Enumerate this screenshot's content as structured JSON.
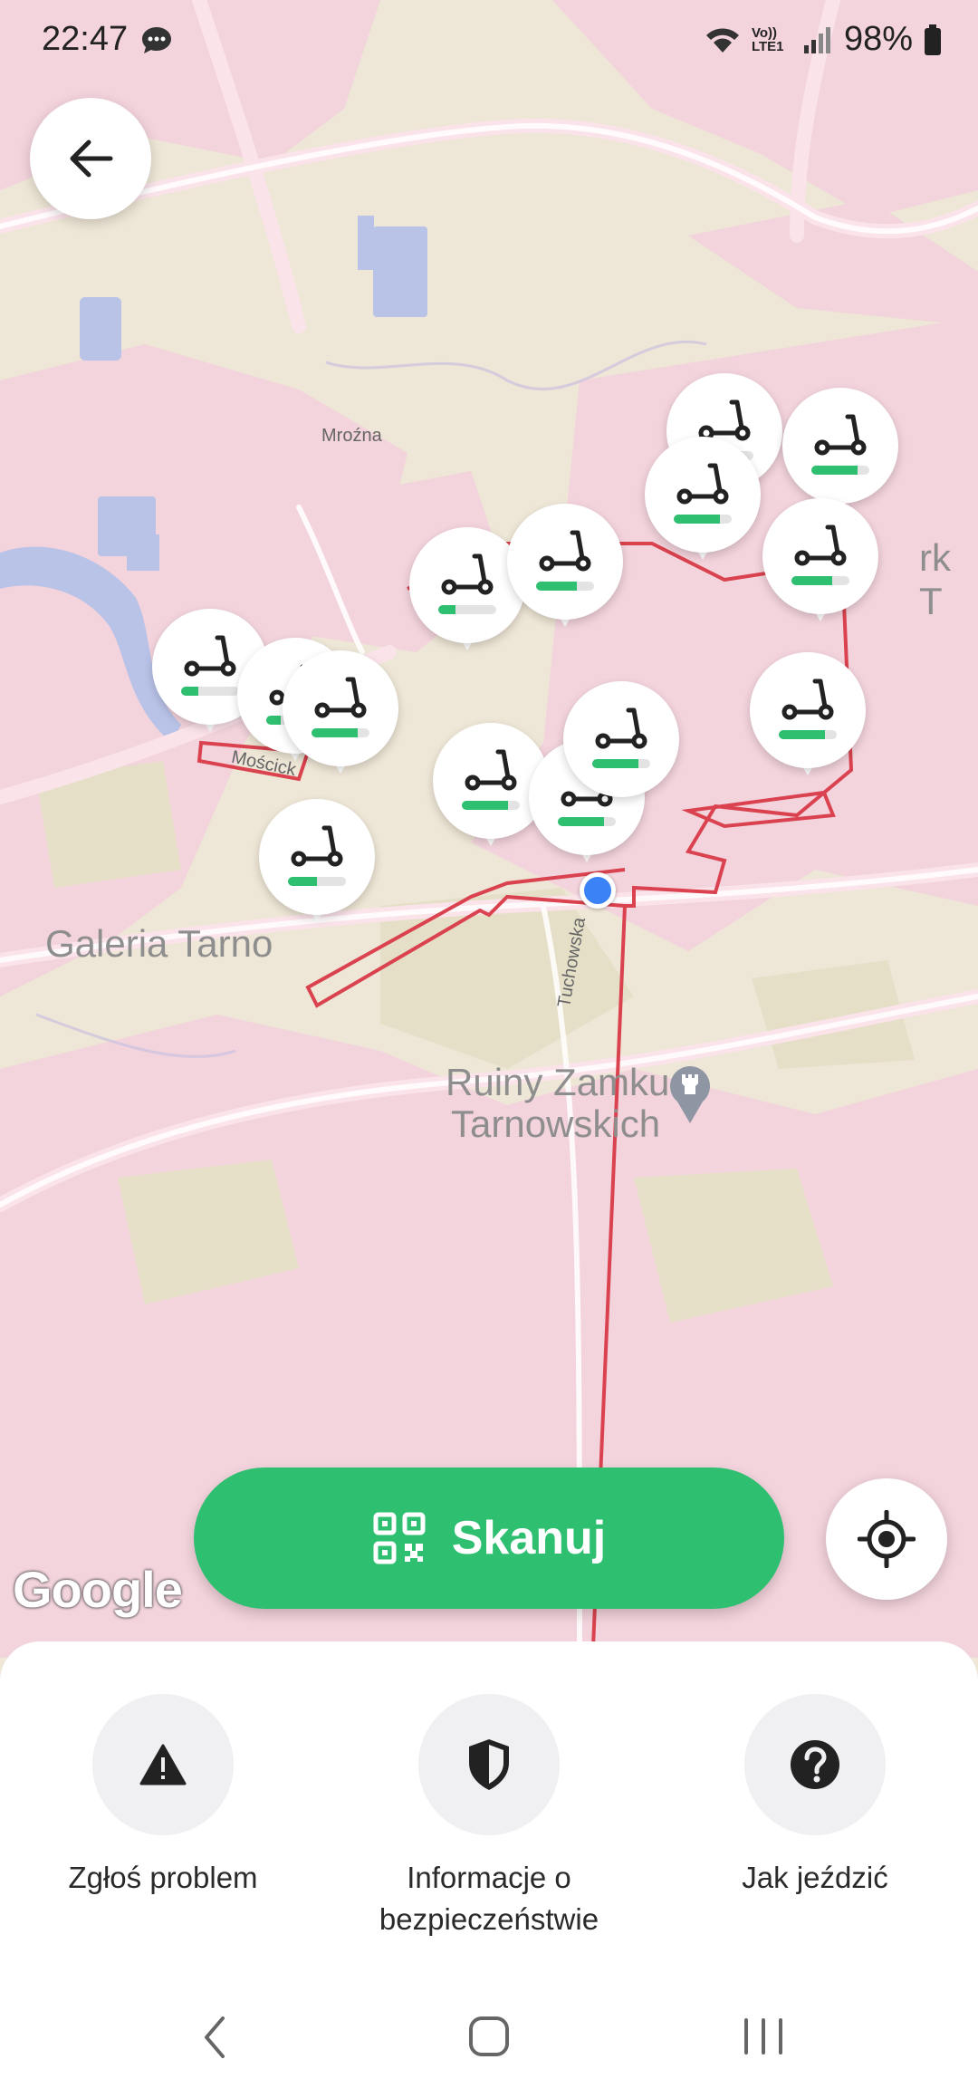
{
  "status_bar": {
    "time": "22:47",
    "network": "Vo)) LTE1",
    "battery": "98%"
  },
  "map": {
    "labels": {
      "mrozna": "Mroźna",
      "moscicka": "Mościck",
      "galeria": "Galeria Tarno",
      "tuchowska": "Tuchowska",
      "ruiny_line1": "Ruiny Zamku",
      "ruiny_line2": "Tarnowskich",
      "park_fragment": "rk T"
    },
    "attribution": "Google",
    "scooter_pins": [
      {
        "battery": 0.8
      },
      {
        "battery": 0.8
      },
      {
        "battery": 0.3
      },
      {
        "battery": 0.7
      },
      {
        "battery": 0.3
      },
      {
        "battery": 0.25
      },
      {
        "battery": 0.8
      },
      {
        "battery": 0.7
      },
      {
        "battery": 0.8
      },
      {
        "battery": 0.8
      },
      {
        "battery": 0.8
      },
      {
        "battery": 0.5
      },
      {
        "battery": 0.8
      },
      {
        "battery": 0.8
      }
    ]
  },
  "scan_button": {
    "label": "Skanuj"
  },
  "actions": [
    {
      "label": "Zgłoś problem",
      "icon": "warning-icon"
    },
    {
      "label": "Informacje o bezpieczeństwie",
      "icon": "shield-icon"
    },
    {
      "label": "Jak jeździć",
      "icon": "question-icon"
    }
  ],
  "colors": {
    "accent": "#2fbf71",
    "zone_border": "#d9424e",
    "user_location": "#3b82f6"
  }
}
